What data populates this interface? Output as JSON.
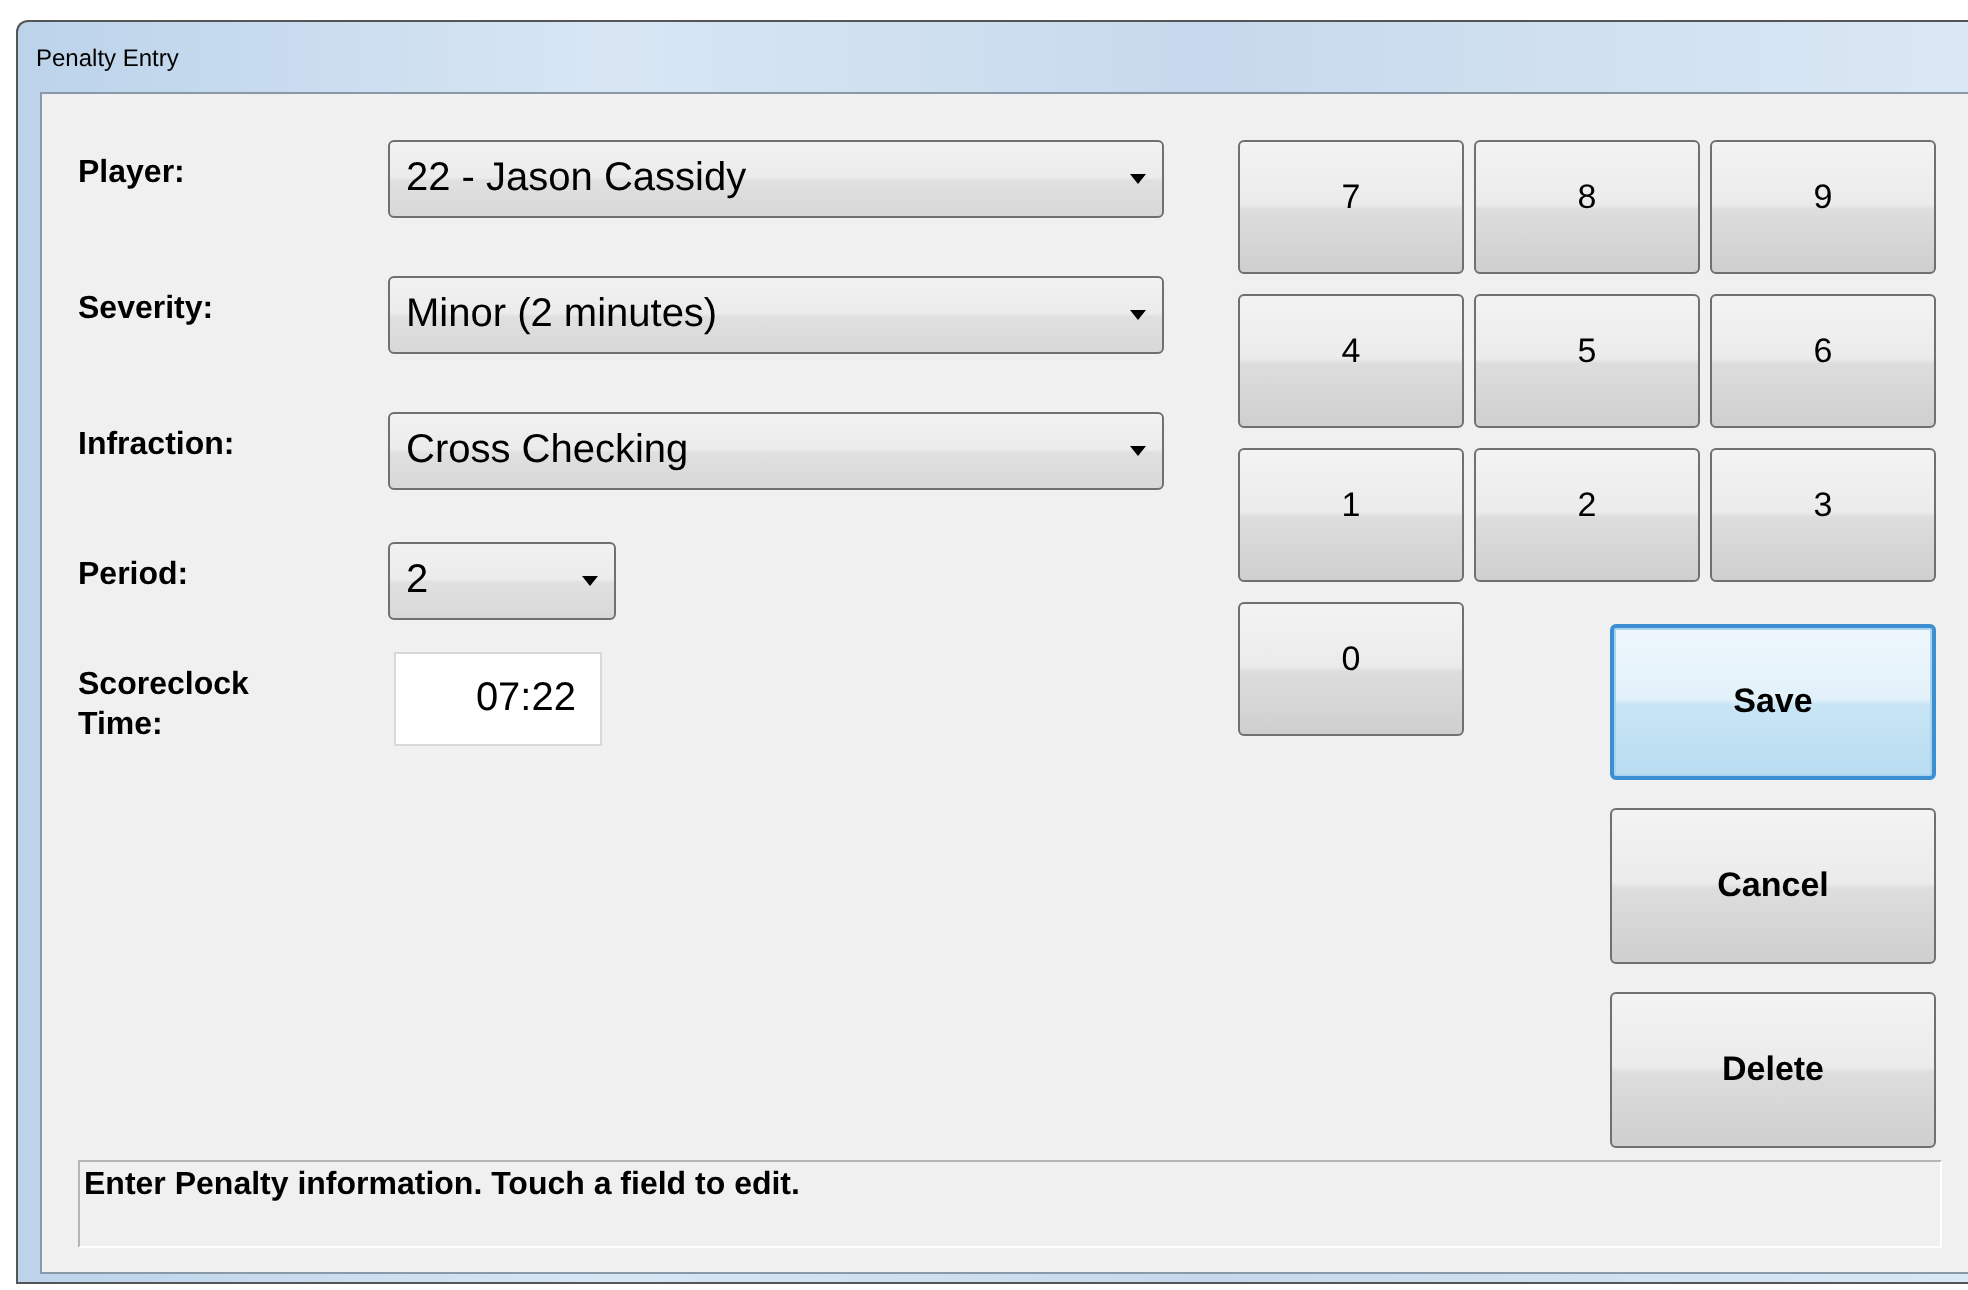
{
  "window": {
    "title": "Penalty Entry"
  },
  "fields": [
    {
      "kind": "select",
      "label": "Player:",
      "value": "22 - Jason Cassidy"
    },
    {
      "kind": "select",
      "label": "Severity:",
      "value": "Minor (2 minutes)"
    },
    {
      "kind": "select",
      "label": "Infraction:",
      "value": "Cross Checking"
    },
    {
      "kind": "select",
      "label": "Period:",
      "value": "2"
    },
    {
      "kind": "text",
      "label": "Scoreclock Time:",
      "value": "07:22"
    }
  ],
  "keypad": [
    "7",
    "8",
    "9",
    "4",
    "5",
    "6",
    "1",
    "2",
    "3",
    "0"
  ],
  "actions": [
    {
      "label": "Save",
      "focused": true
    },
    {
      "label": "Cancel",
      "focused": false
    },
    {
      "label": "Delete",
      "focused": false
    }
  ],
  "status_bar": "Enter Penalty information. Touch a field to edit."
}
